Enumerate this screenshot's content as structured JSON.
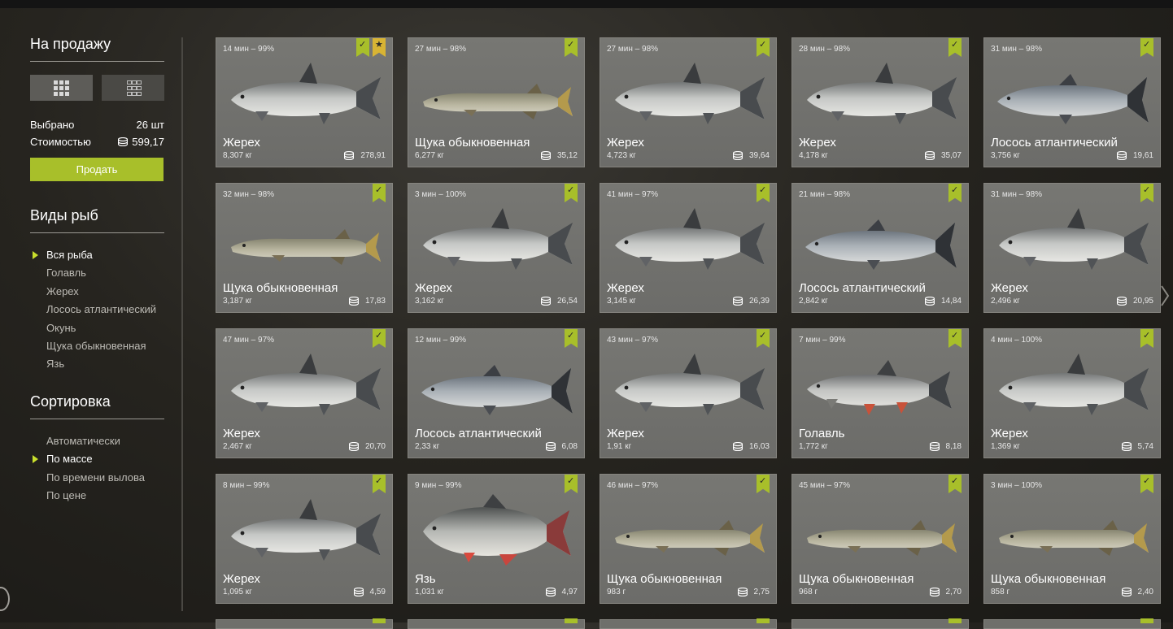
{
  "sidebar": {
    "for_sale_title": "На продажу",
    "selected_label": "Выбрано",
    "selected_value": "26 шт",
    "cost_label": "Стоимостью",
    "cost_value": "599,17",
    "sell_button": "Продать",
    "fish_types_title": "Виды рыб",
    "fish_types": [
      {
        "label": "Вся рыба",
        "active": true
      },
      {
        "label": "Голавль",
        "active": false
      },
      {
        "label": "Жерех",
        "active": false
      },
      {
        "label": "Лосось атлантический",
        "active": false
      },
      {
        "label": "Окунь",
        "active": false
      },
      {
        "label": "Щука обыкновенная",
        "active": false
      },
      {
        "label": "Язь",
        "active": false
      }
    ],
    "sort_title": "Сортировка",
    "sort_options": [
      {
        "label": "Автоматически",
        "active": false
      },
      {
        "label": "По массе",
        "active": true
      },
      {
        "label": "По времени вылова",
        "active": false
      },
      {
        "label": "По цене",
        "active": false
      }
    ]
  },
  "cards": [
    {
      "time": "14 мин – 99%",
      "name": "Жерех",
      "weight": "8,307 кг",
      "price": "278,91",
      "species": "asp",
      "starred": true
    },
    {
      "time": "27 мин – 98%",
      "name": "Щука обыкновенная",
      "weight": "6,277 кг",
      "price": "35,12",
      "species": "pike",
      "starred": false
    },
    {
      "time": "27 мин – 98%",
      "name": "Жерех",
      "weight": "4,723 кг",
      "price": "39,64",
      "species": "asp",
      "starred": false
    },
    {
      "time": "28 мин – 98%",
      "name": "Жерех",
      "weight": "4,178 кг",
      "price": "35,07",
      "species": "asp",
      "starred": false
    },
    {
      "time": "31 мин – 98%",
      "name": "Лосось атлантический",
      "weight": "3,756 кг",
      "price": "19,61",
      "species": "salmon",
      "starred": false
    },
    {
      "time": "32 мин – 98%",
      "name": "Щука обыкновенная",
      "weight": "3,187 кг",
      "price": "17,83",
      "species": "pike",
      "starred": false
    },
    {
      "time": "3 мин – 100%",
      "name": "Жерех",
      "weight": "3,162 кг",
      "price": "26,54",
      "species": "asp",
      "starred": false
    },
    {
      "time": "41 мин – 97%",
      "name": "Жерех",
      "weight": "3,145 кг",
      "price": "26,39",
      "species": "asp",
      "starred": false
    },
    {
      "time": "21 мин – 98%",
      "name": "Лосось атлантический",
      "weight": "2,842 кг",
      "price": "14,84",
      "species": "salmon",
      "starred": false
    },
    {
      "time": "31 мин – 98%",
      "name": "Жерех",
      "weight": "2,496 кг",
      "price": "20,95",
      "species": "asp",
      "starred": false
    },
    {
      "time": "47 мин – 97%",
      "name": "Жерех",
      "weight": "2,467 кг",
      "price": "20,70",
      "species": "asp",
      "starred": false
    },
    {
      "time": "12 мин – 99%",
      "name": "Лосось атлантический",
      "weight": "2,33 кг",
      "price": "6,08",
      "species": "salmon",
      "starred": false
    },
    {
      "time": "43 мин – 97%",
      "name": "Жерех",
      "weight": "1,91 кг",
      "price": "16,03",
      "species": "asp",
      "starred": false
    },
    {
      "time": "7 мин – 99%",
      "name": "Голавль",
      "weight": "1,772 кг",
      "price": "8,18",
      "species": "chub",
      "starred": false
    },
    {
      "time": "4 мин – 100%",
      "name": "Жерех",
      "weight": "1,369 кг",
      "price": "5,74",
      "species": "asp",
      "starred": false
    },
    {
      "time": "8 мин – 99%",
      "name": "Жерех",
      "weight": "1,095 кг",
      "price": "4,59",
      "species": "asp",
      "starred": false
    },
    {
      "time": "9 мин – 99%",
      "name": "Язь",
      "weight": "1,031 кг",
      "price": "4,97",
      "species": "ide",
      "starred": false
    },
    {
      "time": "46 мин – 97%",
      "name": "Щука обыкновенная",
      "weight": "983 г",
      "price": "2,75",
      "species": "pike",
      "starred": false
    },
    {
      "time": "45 мин – 97%",
      "name": "Щука обыкновенная",
      "weight": "968 г",
      "price": "2,70",
      "species": "pike",
      "starred": false
    },
    {
      "time": "3 мин – 100%",
      "name": "Щука обыкновенная",
      "weight": "858 г",
      "price": "2,40",
      "species": "pike",
      "starred": false
    }
  ],
  "colors": {
    "accent": "#a8bf2a",
    "star": "#d8b434",
    "card": "#737370"
  }
}
